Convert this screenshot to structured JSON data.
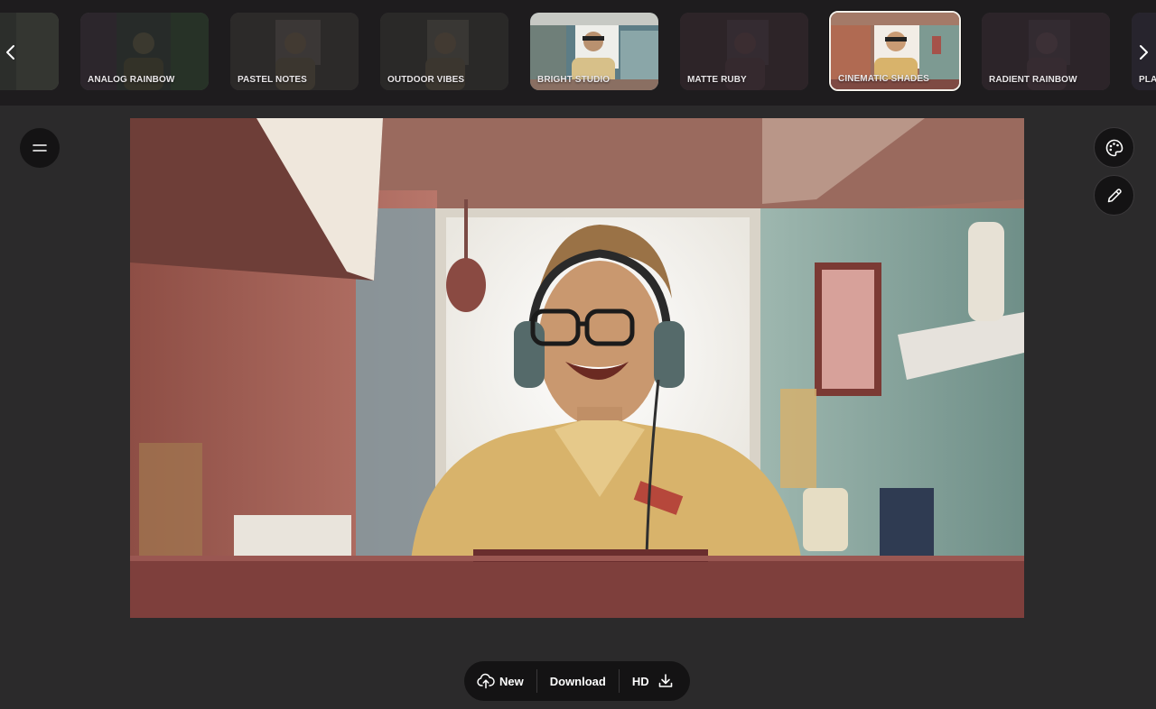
{
  "styles": [
    {
      "label": "",
      "state": "dim",
      "partial": "left"
    },
    {
      "label": "ANALOG RAINBOW",
      "state": "dim"
    },
    {
      "label": "PASTEL NOTES",
      "state": "dim"
    },
    {
      "label": "OUTDOOR VIBES",
      "state": "dim"
    },
    {
      "label": "BRIGHT STUDIO",
      "state": "active"
    },
    {
      "label": "MATTE RUBY",
      "state": "dim"
    },
    {
      "label": "CINEMATIC SHADES",
      "state": "selected"
    },
    {
      "label": "RADIENT RAINBOW",
      "state": "dim"
    },
    {
      "label": "PLAY",
      "state": "dim",
      "partial": "right"
    }
  ],
  "selected_style": "CINEMATIC SHADES",
  "actions": {
    "new_label": "New",
    "download_label": "Download",
    "hd_label": "HD"
  },
  "icons": {
    "menu": "hamburger-icon",
    "palette": "palette-icon",
    "edit": "pencil-icon",
    "upload": "cloud-upload-icon",
    "download": "download-icon",
    "prev": "chevron-left-icon",
    "next": "chevron-right-icon"
  },
  "colors": {
    "background": "#2b2a2b",
    "strip": "#1e1c1e",
    "button": "#141314",
    "selected_border": "#f3efe9"
  }
}
